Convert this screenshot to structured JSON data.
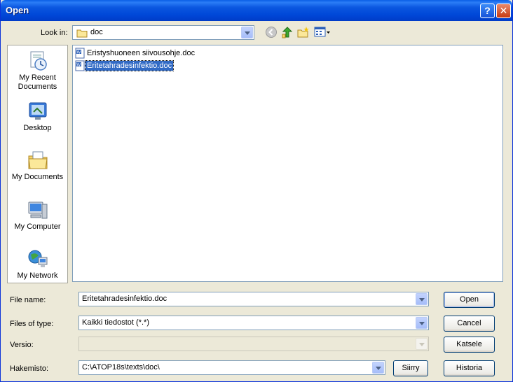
{
  "window": {
    "title": "Open"
  },
  "lookin": {
    "label": "Look in:",
    "value": "doc"
  },
  "places": [
    {
      "label": "My Recent Documents",
      "icon": "recent-documents-icon"
    },
    {
      "label": "Desktop",
      "icon": "desktop-icon"
    },
    {
      "label": "My Documents",
      "icon": "my-documents-icon"
    },
    {
      "label": "My Computer",
      "icon": "my-computer-icon"
    },
    {
      "label": "My Network",
      "icon": "my-network-icon"
    }
  ],
  "files": [
    {
      "name": "Eristyshuoneen siivousohje.doc",
      "selected": false
    },
    {
      "name": "Eritetahradesinfektio.doc",
      "selected": true
    }
  ],
  "filename": {
    "label": "File name:",
    "value": "Eritetahradesinfektio.doc"
  },
  "filetype": {
    "label": "Files of type:",
    "value": "Kaikki tiedostot (*.*)"
  },
  "versio": {
    "label": "Versio:",
    "value": ""
  },
  "hakemisto": {
    "label": "Hakemisto:",
    "value": "C:\\ATOP18s\\texts\\doc\\"
  },
  "buttons": {
    "open": "Open",
    "cancel": "Cancel",
    "katsele": "Katsele",
    "siirry": "Siirry",
    "historia": "Historia"
  },
  "colors": {
    "titlebar": "#0054e3",
    "selection": "#316ac5",
    "dialog_bg": "#ece9d8"
  }
}
